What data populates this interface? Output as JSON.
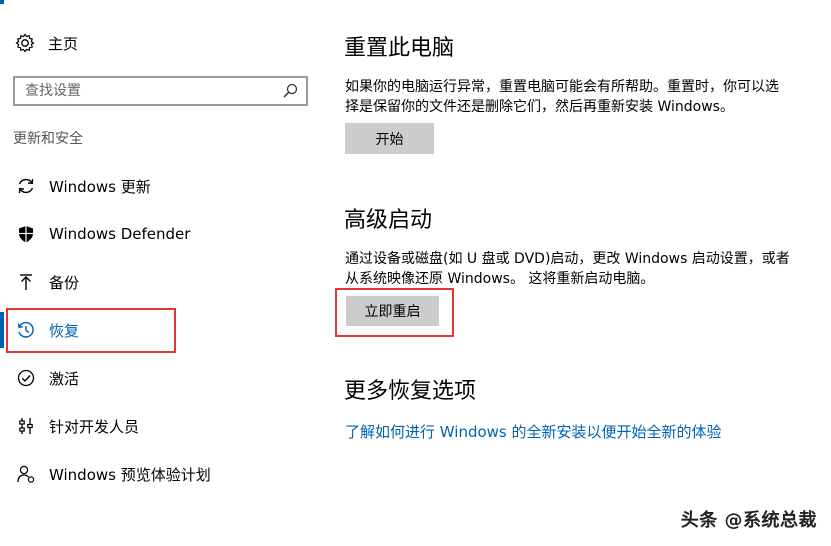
{
  "nav": {
    "home": "主页",
    "search": {
      "placeholder": "查找设置"
    },
    "section_title": "更新和安全",
    "items": [
      {
        "label": "Windows 更新",
        "icon": "sync-icon"
      },
      {
        "label": "Windows Defender",
        "icon": "shield-icon"
      },
      {
        "label": "备份",
        "icon": "upload-icon"
      },
      {
        "label": "恢复",
        "icon": "history-icon",
        "active": true
      },
      {
        "label": "激活",
        "icon": "check-circle-icon"
      },
      {
        "label": "针对开发人员",
        "icon": "developer-icon"
      },
      {
        "label": "Windows 预览体验计划",
        "icon": "person-icon"
      }
    ]
  },
  "reset": {
    "title": "重置此电脑",
    "desc": "如果你的电脑运行异常，重置电脑可能会有所帮助。重置时，你可以选择是保留你的文件还是删除它们，然后再重新安装 Windows。",
    "button": "开始"
  },
  "advanced": {
    "title": "高级启动",
    "desc": "通过设备或磁盘(如 U 盘或 DVD)启动，更改 Windows 启动设置，或者从系统映像还原 Windows。 这将重新启动电脑。",
    "button": "立即重启"
  },
  "more": {
    "title": "更多恢复选项",
    "link": "了解如何进行 Windows 的全新安装以便开始全新的体验"
  },
  "watermark": "头条 @系统总裁",
  "colors": {
    "accent": "#0063b1",
    "highlight": "#e03535",
    "button": "#cccccc"
  }
}
